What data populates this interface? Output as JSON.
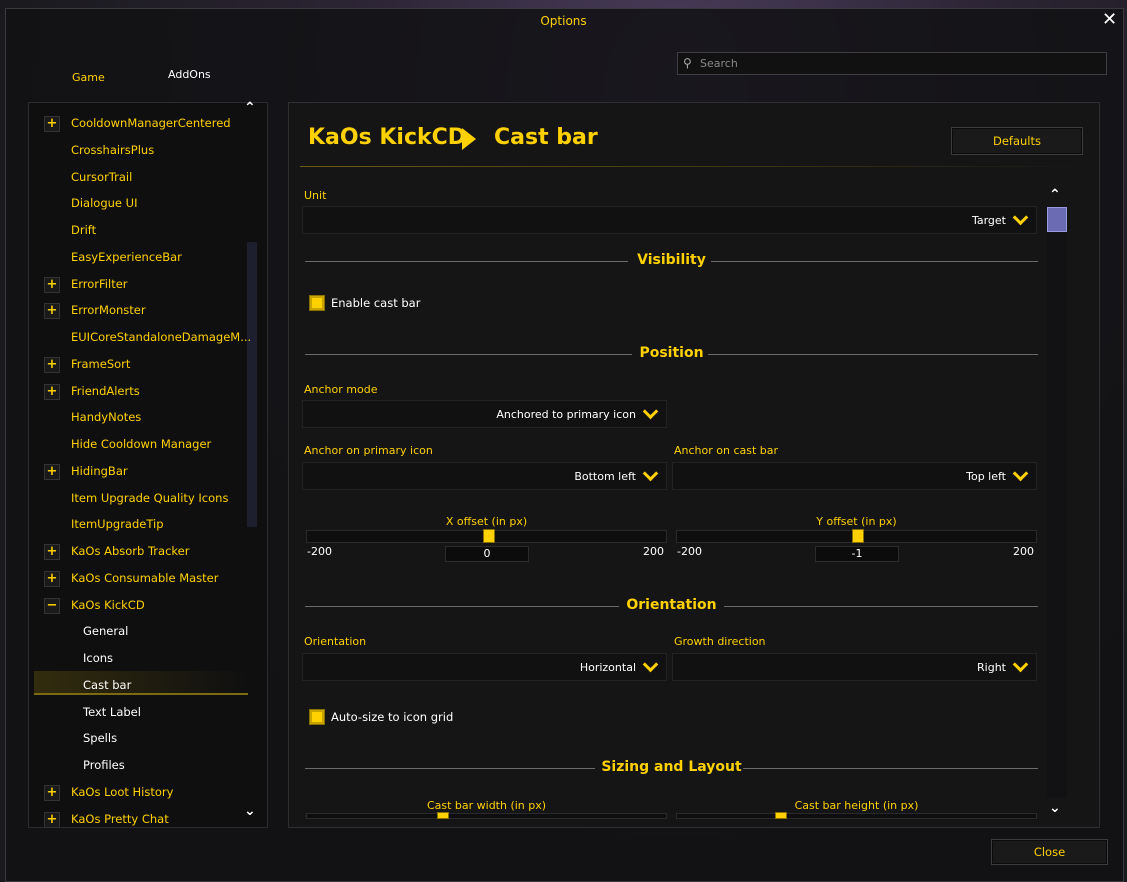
{
  "window": {
    "title": "Options",
    "close_glyph": "✕"
  },
  "tabs": [
    {
      "label": "Game"
    },
    {
      "label": "AddOns"
    }
  ],
  "search": {
    "placeholder": "Search"
  },
  "sidebar": {
    "items": [
      {
        "label": "CooldownManagerCentered",
        "expandable": true
      },
      {
        "label": "CrosshairsPlus"
      },
      {
        "label": "CursorTrail"
      },
      {
        "label": "Dialogue UI"
      },
      {
        "label": "Drift"
      },
      {
        "label": "EasyExperienceBar"
      },
      {
        "label": "ErrorFilter",
        "expandable": true
      },
      {
        "label": "ErrorMonster",
        "expandable": true
      },
      {
        "label": "EUICoreStandaloneDamageM..."
      },
      {
        "label": "FrameSort",
        "expandable": true
      },
      {
        "label": "FriendAlerts",
        "expandable": true
      },
      {
        "label": "HandyNotes"
      },
      {
        "label": "Hide Cooldown Manager"
      },
      {
        "label": "HidingBar",
        "expandable": true
      },
      {
        "label": "Item Upgrade Quality Icons"
      },
      {
        "label": "ItemUpgradeTip"
      },
      {
        "label": "KaOs Absorb Tracker",
        "expandable": true
      },
      {
        "label": "KaOs Consumable Master",
        "expandable": true
      },
      {
        "label": "KaOs KickCD",
        "expanded": true
      },
      {
        "label": "General",
        "sub": true
      },
      {
        "label": "Icons",
        "sub": true
      },
      {
        "label": "Cast bar",
        "sub": true,
        "selected": true
      },
      {
        "label": "Text Label",
        "sub": true
      },
      {
        "label": "Spells",
        "sub": true
      },
      {
        "label": "Profiles",
        "sub": true
      },
      {
        "label": "KaOs Loot History",
        "expandable": true
      },
      {
        "label": "KaOs Pretty Chat",
        "expandable": true
      }
    ]
  },
  "header": {
    "addon": "KaOs KickCD",
    "page": "Cast bar",
    "defaults_label": "Defaults"
  },
  "unit": {
    "label": "Unit",
    "value": "Target"
  },
  "sections": {
    "visibility": "Visibility",
    "position": "Position",
    "orientation": "Orientation",
    "sizing": "Sizing and Layout"
  },
  "visibility": {
    "enable_label": "Enable cast bar",
    "enabled": true
  },
  "position": {
    "anchor_mode": {
      "label": "Anchor mode",
      "value": "Anchored to primary icon"
    },
    "anchor_primary": {
      "label": "Anchor on primary icon",
      "value": "Bottom left"
    },
    "anchor_castbar": {
      "label": "Anchor on cast bar",
      "value": "Top left"
    },
    "x_offset": {
      "label": "X offset (in px)",
      "min": "-200",
      "max": "200",
      "value": "0",
      "fraction": 0.5
    },
    "y_offset": {
      "label": "Y offset (in px)",
      "min": "-200",
      "max": "200",
      "value": "-1",
      "fraction": 0.4975
    }
  },
  "orientation": {
    "orientation": {
      "label": "Orientation",
      "value": "Horizontal"
    },
    "growth": {
      "label": "Growth direction",
      "value": "Right"
    },
    "autosize_label": "Auto-size to icon grid",
    "autosize": true
  },
  "sizing": {
    "width_label": "Cast bar width (in px)",
    "height_label": "Cast bar height (in px)"
  },
  "footer": {
    "close_label": "Close"
  },
  "colors": {
    "accent": "#ffd100",
    "scroll_grip": "#6b6bb3"
  }
}
